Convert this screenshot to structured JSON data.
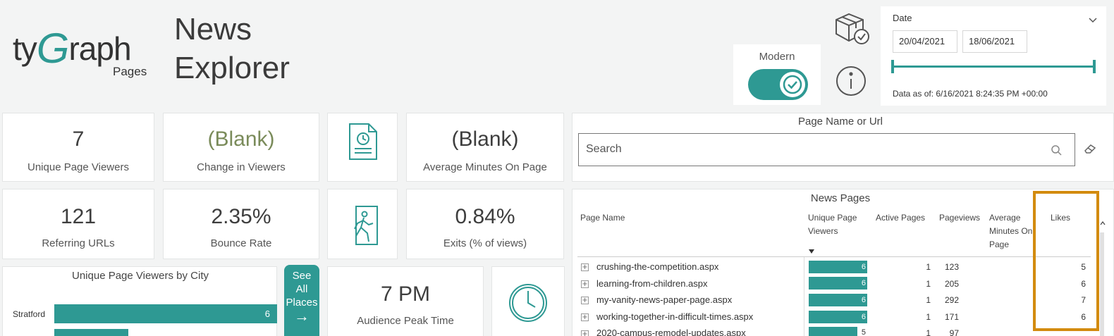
{
  "brand": {
    "logo_prefix": "ty",
    "logo_g": "G",
    "logo_suffix": "raph",
    "logo_sub": "Pages"
  },
  "title": {
    "line1": "News",
    "line2": "Explorer"
  },
  "modern": {
    "label": "Modern"
  },
  "date": {
    "label": "Date",
    "start": "20/04/2021",
    "end": "18/06/2021",
    "as_of": "Data as of: 6/16/2021 8:24:35 PM +00:00"
  },
  "kpis": {
    "unique_viewers": {
      "value": "7",
      "label": "Unique Page Viewers"
    },
    "change_viewers": {
      "value": "(Blank)",
      "label": "Change in Viewers"
    },
    "avg_minutes": {
      "value": "(Blank)",
      "label": "Average Minutes On Page"
    },
    "referring_urls": {
      "value": "121",
      "label": "Referring URLs"
    },
    "bounce_rate": {
      "value": "2.35%",
      "label": "Bounce Rate"
    },
    "exits": {
      "value": "0.84%",
      "label": "Exits (% of views)"
    },
    "peak_time": {
      "value": "7 PM",
      "label": "Audience Peak Time"
    }
  },
  "city_chart": {
    "title": "Unique Page Viewers by City",
    "rows": [
      {
        "city": "Stratford",
        "value": "6"
      }
    ]
  },
  "see_all": {
    "line1": "See",
    "line2": "All",
    "line3": "Places",
    "arrow": "→"
  },
  "search": {
    "title": "Page Name or Url",
    "placeholder": "Search"
  },
  "table": {
    "title": "News Pages",
    "headers": {
      "page_name": "Page Name",
      "viewers_1": "Unique Page",
      "viewers_2": "Viewers",
      "active": "Active Pages",
      "pageviews": "Pageviews",
      "avg_1": "Average",
      "avg_2": "Minutes On",
      "avg_3": "Page",
      "likes": "Likes"
    },
    "rows": [
      {
        "name": "crushing-the-competition.aspx",
        "viewers": "6",
        "active": "1",
        "pageviews": "123",
        "likes": "5"
      },
      {
        "name": "learning-from-children.aspx",
        "viewers": "6",
        "active": "1",
        "pageviews": "205",
        "likes": "6"
      },
      {
        "name": "my-vanity-news-paper-page.aspx",
        "viewers": "6",
        "active": "1",
        "pageviews": "292",
        "likes": "7"
      },
      {
        "name": "working-together-in-difficult-times.aspx",
        "viewers": "6",
        "active": "1",
        "pageviews": "171",
        "likes": "6"
      },
      {
        "name": "2020-campus-remodel-updates.aspx",
        "viewers": "5",
        "active": "1",
        "pageviews": "97",
        "likes": ""
      }
    ]
  },
  "colors": {
    "accent": "#2e9993",
    "highlight": "#d38b0f",
    "blank_text": "#7a8b5a"
  },
  "icons": [
    "package-check-icon",
    "info-icon",
    "document-clock-icon",
    "exit-running-icon",
    "clock-icon",
    "search-icon",
    "eraser-icon",
    "chevron-down-icon",
    "sort-desc-icon",
    "expand-plus-icon"
  ]
}
